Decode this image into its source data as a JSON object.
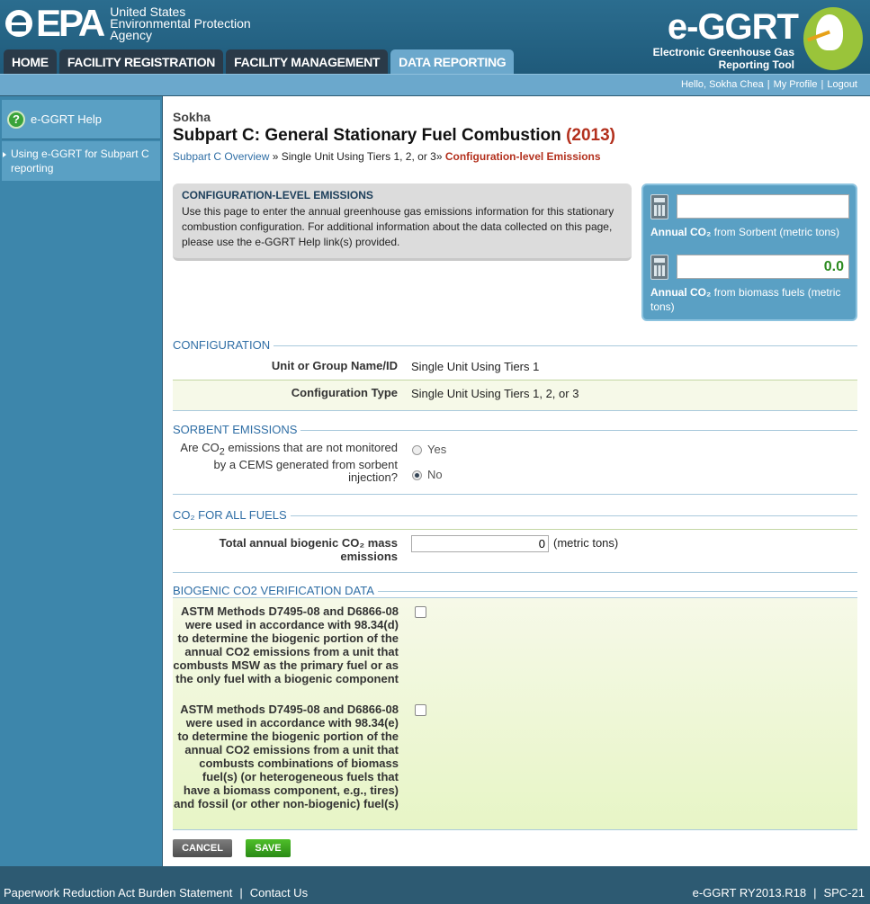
{
  "header": {
    "epa_letters": "EPA",
    "agency_line1": "United States",
    "agency_line2": "Environmental Protection",
    "agency_line3": "Agency",
    "app_title": "e-GGRT",
    "app_subtitle1": "Electronic Greenhouse Gas",
    "app_subtitle2": "Reporting Tool"
  },
  "tabs": [
    {
      "label": "HOME",
      "active": false
    },
    {
      "label": "FACILITY REGISTRATION",
      "active": false
    },
    {
      "label": "FACILITY MANAGEMENT",
      "active": false
    },
    {
      "label": "DATA REPORTING",
      "active": true
    }
  ],
  "userbar": {
    "greeting": "Hello, Sokha Chea",
    "profile": "My Profile",
    "logout": "Logout"
  },
  "sidebar": {
    "help_label": "e-GGRT Help",
    "help_link": "Using e-GGRT for Subpart C reporting"
  },
  "page": {
    "facility": "Sokha",
    "title": "Subpart C: General Stationary Fuel Combustion",
    "year": "(2013)",
    "crumb_overview": "Subpart C Overview",
    "crumb_sep": "»",
    "crumb_unit": "Single Unit Using Tiers 1, 2, or 3",
    "crumb_current": "Configuration-level Emissions"
  },
  "info": {
    "title": "CONFIGURATION-LEVEL EMISSIONS",
    "text": "Use this page to enter the annual greenhouse gas emissions information for this stationary combustion configuration. For additional information about the data collected on this page, please use the e-GGRT Help link(s) provided."
  },
  "calc": {
    "sorbent_value": "",
    "sorbent_label_bold": "Annual CO₂",
    "sorbent_label_rest": " from Sorbent (metric tons)",
    "biomass_value": "0.0",
    "biomass_label_bold": "Annual CO₂",
    "biomass_label_rest": " from biomass fuels (metric tons)"
  },
  "configuration": {
    "heading": "CONFIGURATION",
    "unit_label": "Unit or Group Name/ID",
    "unit_value": "Single Unit Using Tiers 1",
    "type_label": "Configuration Type",
    "type_value": "Single Unit Using Tiers 1, 2, or 3"
  },
  "sorbent": {
    "heading": "SORBENT EMISSIONS",
    "question_a": "Are CO",
    "question_sub": "2",
    "question_b": " emissions that are not monitored by a CEMS generated from sorbent injection?",
    "yes": "Yes",
    "no": "No",
    "selected": "No"
  },
  "co2_fuels": {
    "heading": "CO₂ FOR ALL FUELS",
    "label": "Total annual biogenic CO₂ mass emissions",
    "value": "0",
    "unit": "(metric tons)"
  },
  "biogenic": {
    "heading": "BIOGENIC CO2 VERIFICATION DATA",
    "item1": "ASTM Methods D7495-08 and D6866-08 were used in accordance with 98.34(d) to determine the biogenic portion of the annual CO2 emissions from a unit that combusts MSW as the primary fuel or as the only fuel with a biogenic component",
    "item1_checked": false,
    "item2": "ASTM methods D7495-08 and D6866-08 were used in accordance with 98.34(e) to determine the biogenic portion of the annual CO2 emissions from a unit that combusts combinations of biomass fuel(s) (or heterogeneous fuels that have a biomass component, e.g., tires) and fossil (or other non-biogenic) fuel(s)",
    "item2_checked": false
  },
  "buttons": {
    "cancel": "CANCEL",
    "save": "SAVE"
  },
  "footer": {
    "paperwork": "Paperwork Reduction Act Burden Statement",
    "contact": "Contact Us",
    "version": "e-GGRT RY2013.R18",
    "screen_id": "SPC-21"
  },
  "colors": {
    "header_blue": "#1f5a7a",
    "active_tab": "#6ba8cc",
    "title_red": "#b3301d",
    "link_blue": "#2f6ea5",
    "save_green": "#2a8a16",
    "band_bg": "#f6f9e8"
  }
}
